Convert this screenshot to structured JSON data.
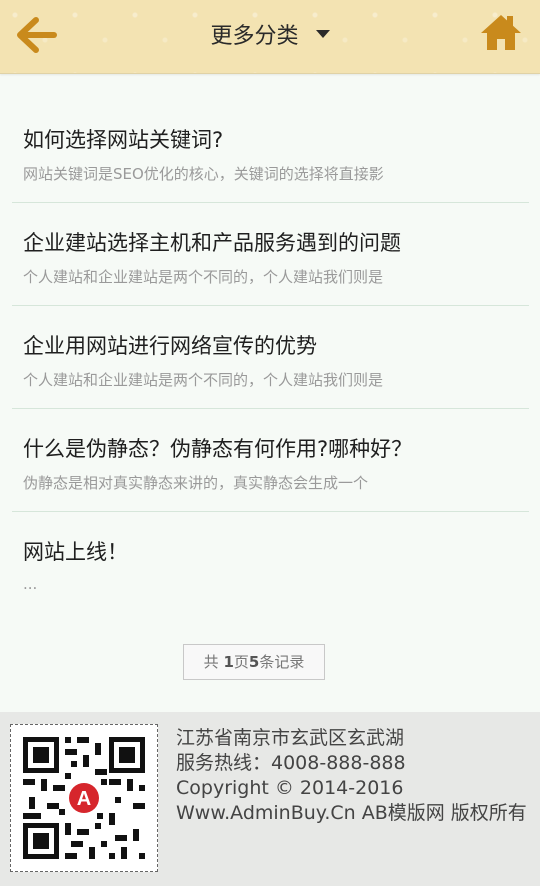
{
  "header": {
    "title": "更多分类",
    "back_icon": "back-arrow-icon",
    "home_icon": "home-icon",
    "accent_color": "#c98a1c"
  },
  "articles": [
    {
      "title": "如何选择网站关键词?",
      "desc": "网站关键词是SEO优化的核心，关键词的选择将直接影"
    },
    {
      "title": "企业建站选择主机和产品服务遇到的问题",
      "desc": "个人建站和企业建站是两个不同的，个人建站我们则是"
    },
    {
      "title": "企业用网站进行网络宣传的优势",
      "desc": "个人建站和企业建站是两个不同的，个人建站我们则是"
    },
    {
      "title": "什么是伪静态？伪静态有何作用?哪种好？",
      "desc": "伪静态是相对真实静态来讲的，真实静态会生成一个"
    },
    {
      "title": "网站上线！",
      "desc": "..."
    }
  ],
  "pager": {
    "prefix": "共 ",
    "pages": "1",
    "pages_unit": "页",
    "records": "5",
    "records_unit": "条记录"
  },
  "footer": {
    "address": "江苏省南京市玄武区玄武湖",
    "hotline": "服务热线：4008-888-888",
    "copyright": "Copyright © 2014-2016",
    "site": "Www.AdminBuy.Cn AB模版网 版权所有",
    "qr_icon": "qr-code-icon",
    "qr_badge_letter": "A"
  }
}
